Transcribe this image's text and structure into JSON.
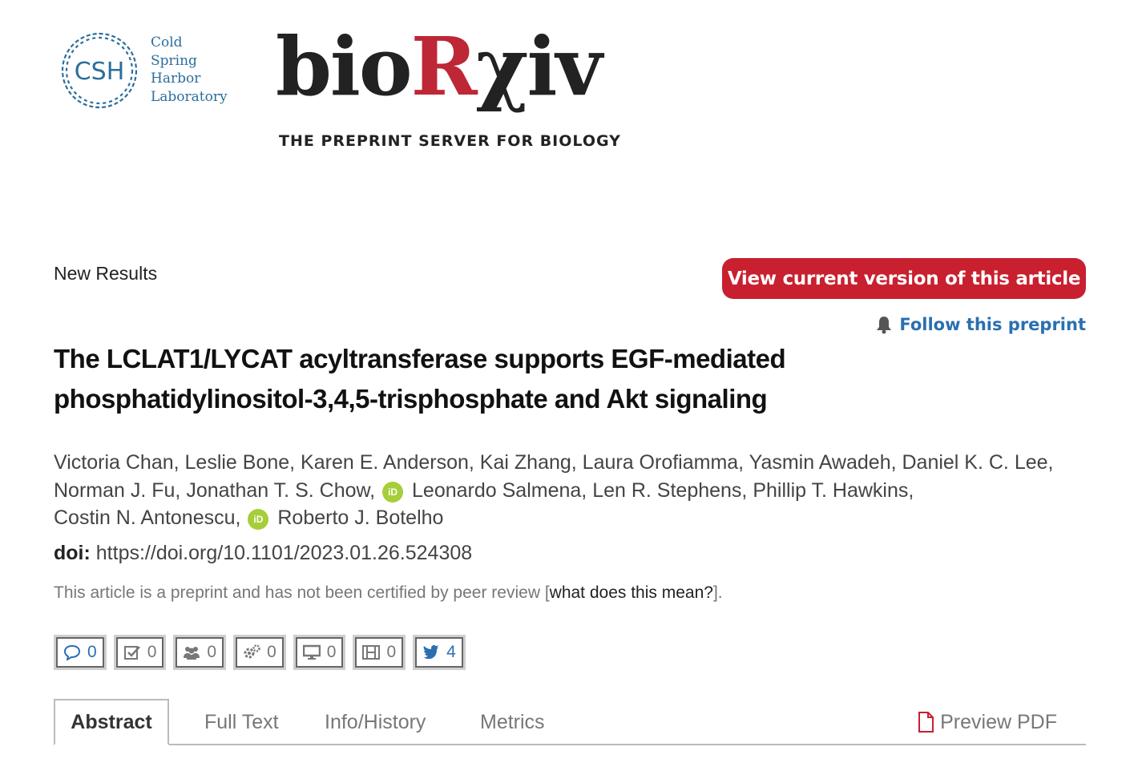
{
  "header": {
    "csh_lines": [
      "Cold",
      "Spring",
      "Harbor",
      "Laboratory"
    ],
    "csh_mark": "CSH",
    "site_name_prefix": "bio",
    "site_name_accent": "R",
    "site_name_suffix": "χiv",
    "tagline": "THE PREPRINT SERVER FOR BIOLOGY"
  },
  "article": {
    "section": "New Results",
    "current_version_button": "View current version of this article",
    "follow_label": "Follow this preprint",
    "title": "The LCLAT1/LYCAT acyltransferase supports EGF-mediated phosphatidylinositol-3,4,5-trisphosphate and Akt signaling",
    "authors_line1": "Victoria Chan, Leslie Bone, Karen E. Anderson, Kai Zhang, Laura Orofiamma, Yasmin Awadeh, Daniel K. C. Lee,",
    "authors_line2a": "Norman J. Fu, Jonathan T. S. Chow,",
    "authors_line2b": "Leonardo Salmena, Len R. Stephens, Phillip T. Hawkins,",
    "authors_line3a": "Costin N. Antonescu,",
    "authors_line3b": "Roberto J. Botelho",
    "orcid_badge": "iD",
    "doi_label": "doi:",
    "doi_url": "https://doi.org/10.1101/2023.01.26.524308",
    "preprint_note": "This article is a preprint and has not been certified by peer review [",
    "preprint_link": "what does this mean?",
    "preprint_note_end": "]."
  },
  "metrics": [
    {
      "icon": "comment-icon",
      "count": "0"
    },
    {
      "icon": "checkbox-icon",
      "count": "0"
    },
    {
      "icon": "users-icon",
      "count": "0"
    },
    {
      "icon": "cogs-icon",
      "count": "0"
    },
    {
      "icon": "monitor-icon",
      "count": "0"
    },
    {
      "icon": "film-icon",
      "count": "0"
    },
    {
      "icon": "twitter-icon",
      "count": "4"
    }
  ],
  "tabs": [
    "Abstract",
    "Full Text",
    "Info/History",
    "Metrics"
  ],
  "preview_pdf": "Preview PDF",
  "colors": {
    "brand_red": "#c8202f",
    "link_blue": "#2a6fb0",
    "csh_blue": "#2b6e9c",
    "orcid_green": "#a6ce39"
  }
}
